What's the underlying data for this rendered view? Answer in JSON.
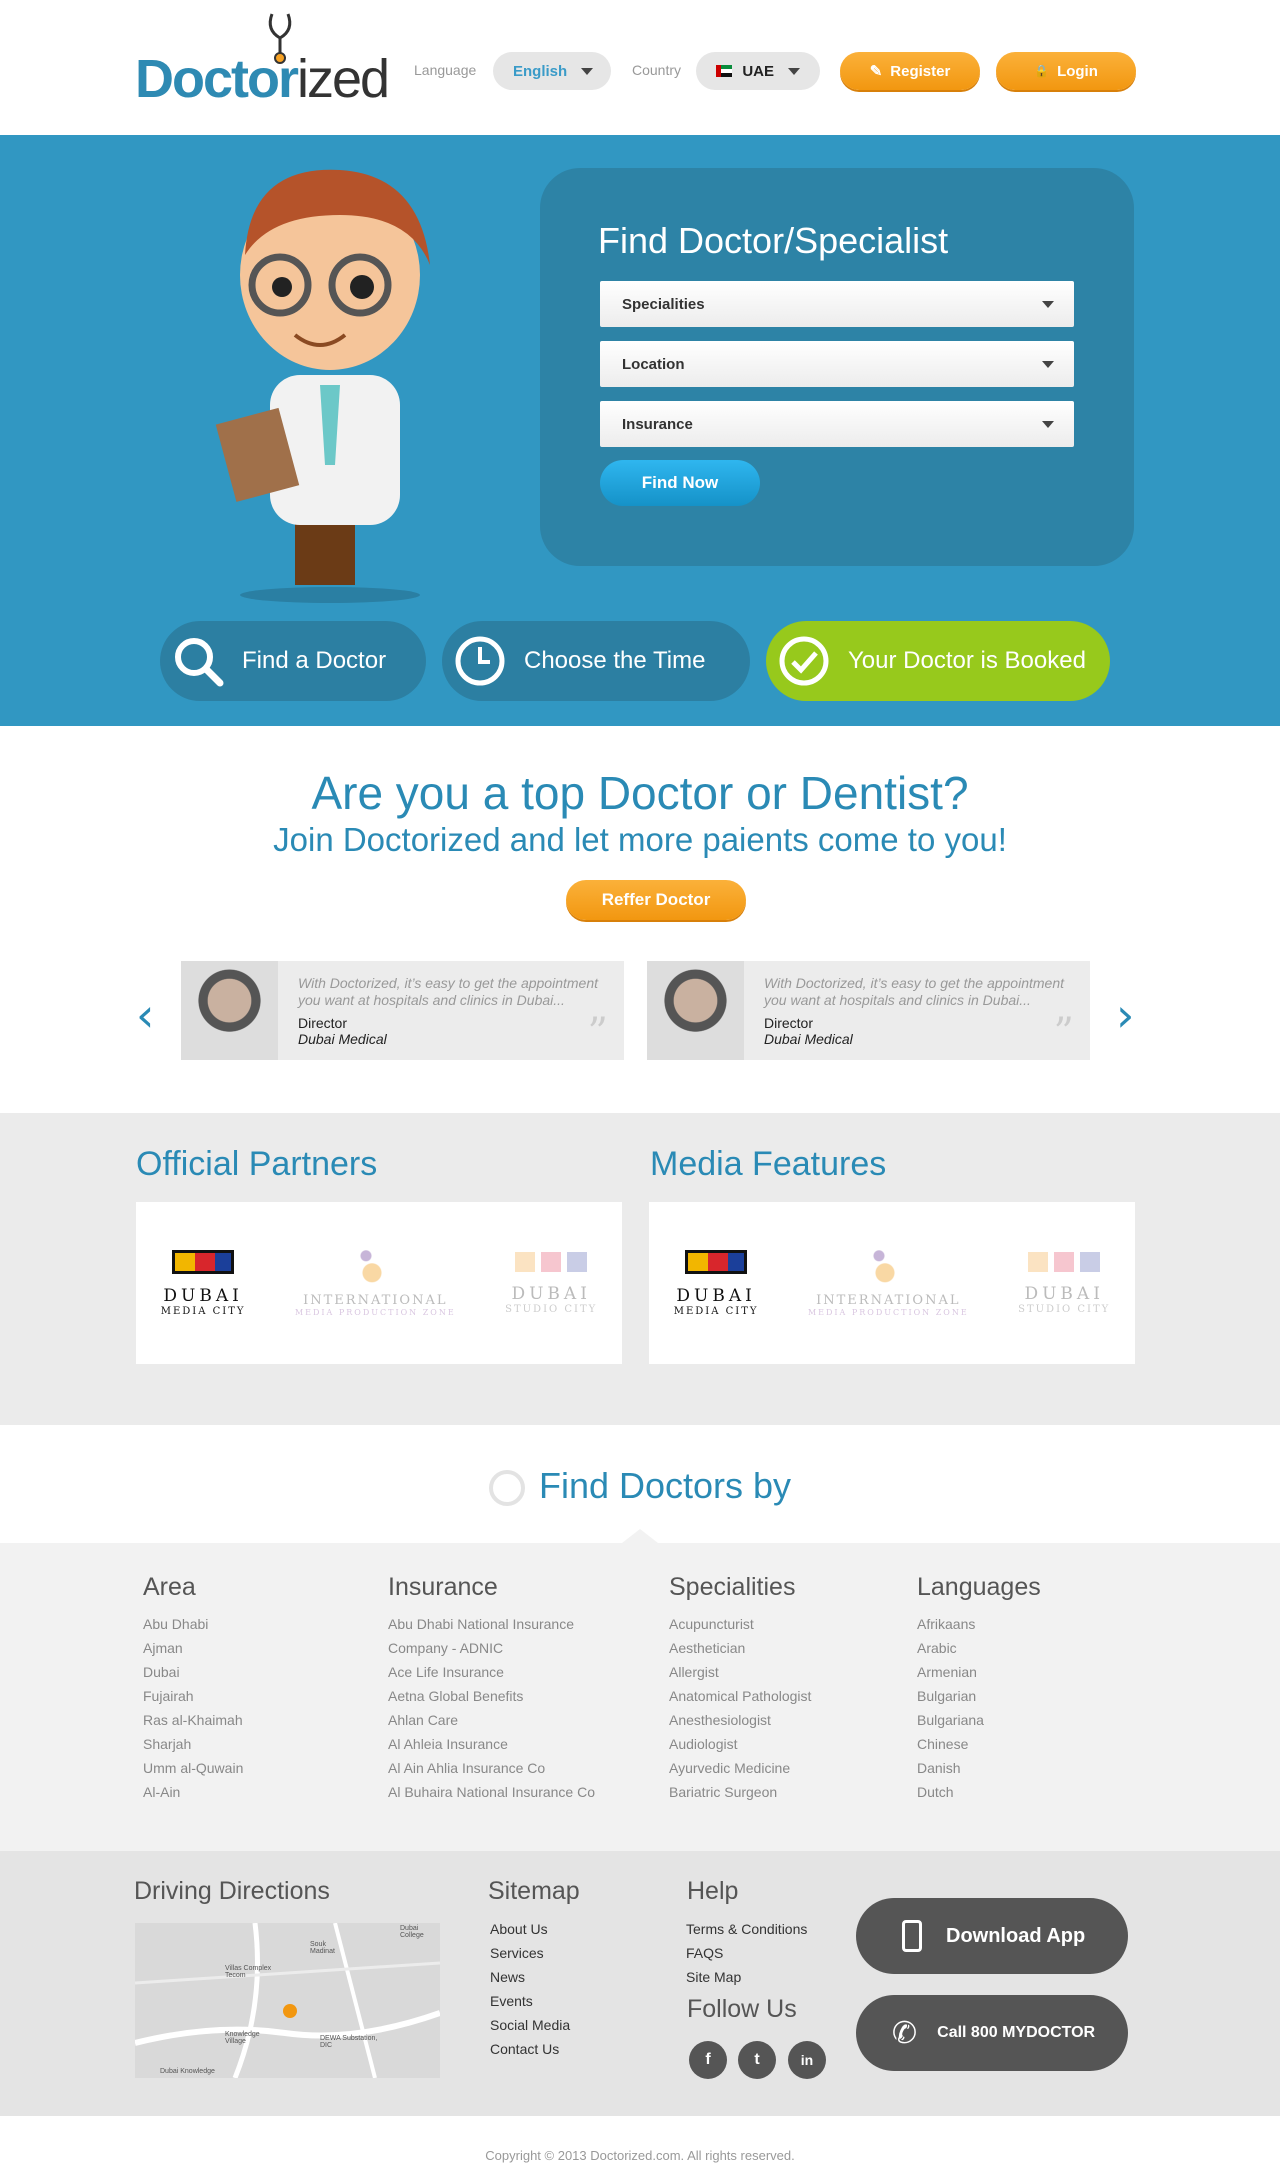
{
  "header": {
    "logo_bold": "Doctor",
    "logo_light": "ized",
    "language_label": "Language",
    "language_value": "English",
    "country_label": "Country",
    "country_value": "UAE",
    "register_label": "Register",
    "login_label": "Login"
  },
  "hero": {
    "search_title": "Find Doctor/Specialist",
    "selects": [
      "Specialities",
      "Location",
      "Insurance"
    ],
    "find_button": "Find Now",
    "steps": [
      "Find a Doctor",
      "Choose the Time",
      "Your Doctor is Booked"
    ]
  },
  "cta": {
    "heading": "Are you a top Doctor or Dentist?",
    "subheading": "Join Doctorized and let more paients come to you!",
    "button": "Reffer Doctor",
    "testimonials": [
      {
        "quote": "With Doctorized, it’s easy to get the appointment you want at hospitals and clinics in Dubai...",
        "role": "Director",
        "org": "Dubai Medical"
      },
      {
        "quote": "With Doctorized, it’s easy to get the appointment you want at hospitals and clinics in Dubai...",
        "role": "Director",
        "org": "Dubai Medical"
      }
    ]
  },
  "partners": {
    "official_title": "Official Partners",
    "media_title": "Media Features",
    "logos": [
      {
        "line1": "DUBAI",
        "line2": "MEDIA CITY"
      },
      {
        "line1": "INTERNATIONAL",
        "line2": "MEDIA PRODUCTION ZONE"
      },
      {
        "line1": "DUBAI",
        "line2": "STUDIO CITY"
      }
    ]
  },
  "findby": {
    "title": "Find Doctors by",
    "columns": [
      {
        "title": "Area",
        "items": [
          "Abu Dhabi",
          "Ajman",
          "Dubai",
          "Fujairah",
          "Ras al-Khaimah",
          "Sharjah",
          "Umm al-Quwain",
          "Al-Ain"
        ]
      },
      {
        "title": "Insurance",
        "items": [
          "Abu Dhabi National Insurance",
          "Company - ADNIC",
          "Ace Life Insurance",
          "Aetna Global Benefits",
          "Ahlan Care",
          "Al Ahleia Insurance",
          "Al Ain Ahlia Insurance Co",
          "Al Buhaira National Insurance Co"
        ]
      },
      {
        "title": "Specialities",
        "items": [
          "Acupuncturist",
          "Aesthetician",
          "Allergist",
          "Anatomical Pathologist",
          "Anesthesiologist",
          "Audiologist",
          "Ayurvedic Medicine",
          "Bariatric Surgeon"
        ]
      },
      {
        "title": "Languages",
        "items": [
          "Afrikaans",
          "Arabic",
          "Armenian",
          "Bulgarian",
          "Bulgariana",
          "Chinese",
          "Danish",
          "Dutch"
        ]
      }
    ]
  },
  "footer": {
    "directions_title": "Driving Directions",
    "map_labels": [
      "Villas Complex Tecom",
      "Knowledge Village",
      "DEWA Substation, DIC",
      "Souk Madinat",
      "Dubai College",
      "Dubai Knowledge"
    ],
    "sitemap_title": "Sitemap",
    "sitemap": [
      "About Us",
      "Services",
      "News",
      "Events",
      "Social Media",
      "Contact Us"
    ],
    "help_title": "Help",
    "help": [
      "Terms & Conditions",
      "FAQS",
      "Site Map"
    ],
    "follow_title": "Follow Us",
    "social": [
      "f",
      "t",
      "in"
    ],
    "download_app": "Download App",
    "call": "Call 800 MYDOCTOR",
    "copyright": "Copyright © 2013 Doctorized.com. All rights reserved."
  },
  "colors": {
    "brand_blue": "#3197c2",
    "orange": "#f7a224",
    "green": "#9acd1c"
  }
}
